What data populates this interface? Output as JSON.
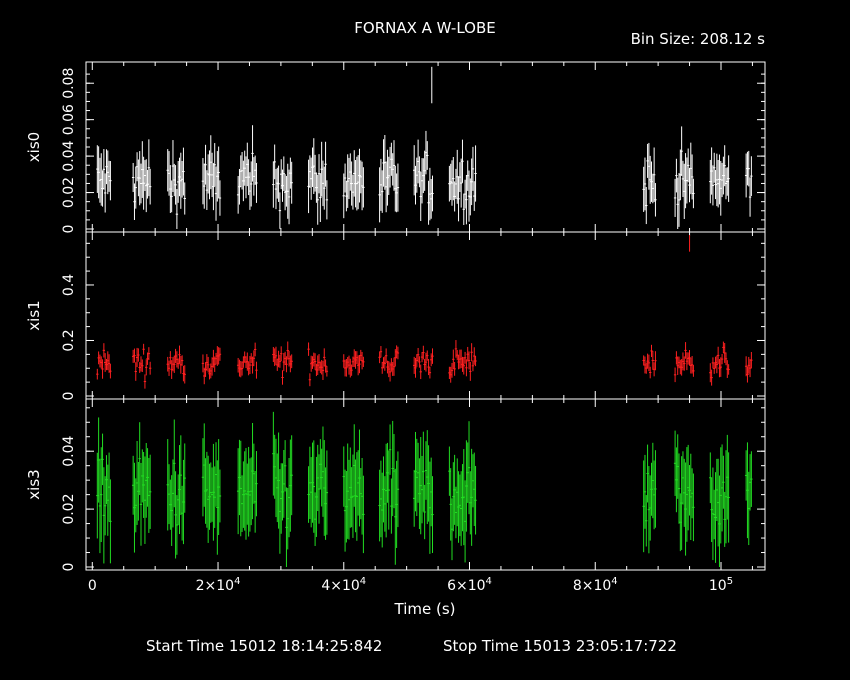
{
  "title": "FORNAX A W-LOBE",
  "bin_size": "Bin Size: 208.12 s",
  "start_time": "Start Time 15012 18:14:25:842",
  "stop_time": "Stop Time 15013 23:05:17:722",
  "colors": {
    "background": "#000000",
    "axes": "#ffffff",
    "xis0": "#ffffff",
    "xis1": "#ff2020",
    "xis3": "#22dd22"
  },
  "chart_data": {
    "type": "scatter",
    "xlabel": "Time (s)",
    "xlim": [
      -1000,
      107000
    ],
    "x_ticks": [
      {
        "value": 0,
        "label": "0"
      },
      {
        "value": 20000,
        "label": "2×10",
        "exp": "4"
      },
      {
        "value": 40000,
        "label": "4×10",
        "exp": "4"
      },
      {
        "value": 60000,
        "label": "6×10",
        "exp": "4"
      },
      {
        "value": 80000,
        "label": "8×10",
        "exp": "4"
      },
      {
        "value": 100000,
        "label": "10",
        "exp": "5"
      }
    ],
    "observation_windows": [
      [
        800,
        3000
      ],
      [
        6500,
        9300
      ],
      [
        12000,
        14800
      ],
      [
        17600,
        20500
      ],
      [
        23200,
        26200
      ],
      [
        28800,
        31800
      ],
      [
        34400,
        37400
      ],
      [
        40000,
        43200
      ],
      [
        45700,
        48800
      ],
      [
        51200,
        54300
      ],
      [
        56800,
        61000
      ],
      [
        87700,
        89600
      ],
      [
        92700,
        95700
      ],
      [
        98300,
        101300
      ],
      [
        104000,
        105000
      ]
    ],
    "series": [
      {
        "name": "xis0",
        "color": "#ffffff",
        "ylim": [
          0,
          0.09
        ],
        "y_ticks": [
          {
            "value": 0,
            "label": "0"
          },
          {
            "value": 0.02,
            "label": "0.02"
          },
          {
            "value": 0.04,
            "label": "0.04"
          },
          {
            "value": 0.06,
            "label": "0.06"
          },
          {
            "value": 0.08,
            "label": "0.08"
          }
        ],
        "mean": 0.026,
        "spread": 0.013,
        "err": 0.013,
        "peak": {
          "x": 54000,
          "y": 0.079,
          "err": 0.01
        }
      },
      {
        "name": "xis1",
        "color": "#ff2020",
        "ylim": [
          0,
          0.58
        ],
        "y_ticks": [
          {
            "value": 0,
            "label": "0"
          },
          {
            "value": 0.2,
            "label": "0.2"
          },
          {
            "value": 0.4,
            "label": "0.4"
          }
        ],
        "mean": 0.12,
        "spread": 0.045,
        "err": 0.03,
        "peak": {
          "x": 95000,
          "y": 0.55,
          "err": 0.03
        }
      },
      {
        "name": "xis3",
        "color": "#22dd22",
        "ylim": [
          0,
          0.057
        ],
        "y_ticks": [
          {
            "value": 0,
            "label": "0"
          },
          {
            "value": 0.02,
            "label": "0.02"
          },
          {
            "value": 0.04,
            "label": "0.04"
          }
        ],
        "mean": 0.025,
        "spread": 0.011,
        "err": 0.014,
        "peak": null
      }
    ]
  }
}
